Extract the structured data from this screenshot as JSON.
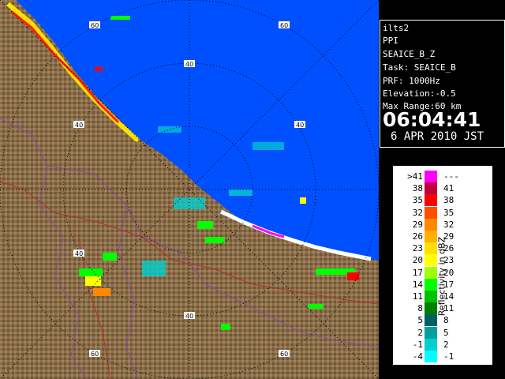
{
  "radar": {
    "ring_labels": {
      "inner": "40",
      "outer": "60"
    },
    "colors": {
      "sea": "#0050ff",
      "land": "#8b6e4a",
      "grid": "#000000",
      "border": "#8a4aa0",
      "road": "#b03030"
    }
  },
  "info": {
    "station": "ilts2",
    "mode": "PPI",
    "product": "SEAICE_B_Z",
    "task": "Task: SEAICE_B",
    "prf": "PRF: 1000Hz",
    "elevation": "Elevation:-0.5",
    "range": "Max Range:60 km",
    "time": "06:04:41",
    "date": "6 APR 2010 JST"
  },
  "legend": {
    "title": "Reflectivity in dBZ",
    "rows": [
      {
        "left": ">41",
        "right": "---",
        "color": "#ff00ff"
      },
      {
        "left": "38",
        "right": "41",
        "color": "#c00040"
      },
      {
        "left": "35",
        "right": "38",
        "color": "#ff0000"
      },
      {
        "left": "32",
        "right": "35",
        "color": "#ff5000"
      },
      {
        "left": "29",
        "right": "32",
        "color": "#ff8800"
      },
      {
        "left": "26",
        "right": "29",
        "color": "#ffb000"
      },
      {
        "left": "23",
        "right": "26",
        "color": "#ffe000"
      },
      {
        "left": "20",
        "right": "23",
        "color": "#ffff00"
      },
      {
        "left": "17",
        "right": "20",
        "color": "#a0ff00"
      },
      {
        "left": "14",
        "right": "17",
        "color": "#00ff00"
      },
      {
        "left": "11",
        "right": "14",
        "color": "#00c000"
      },
      {
        "left": "8",
        "right": "11",
        "color": "#008000"
      },
      {
        "left": "5",
        "right": "8",
        "color": "#006060"
      },
      {
        "left": "2",
        "right": "5",
        "color": "#00a0a0"
      },
      {
        "left": "-1",
        "right": "2",
        "color": "#00d0d0"
      },
      {
        "left": "-4",
        "right": "-1",
        "color": "#00ffff"
      }
    ]
  }
}
